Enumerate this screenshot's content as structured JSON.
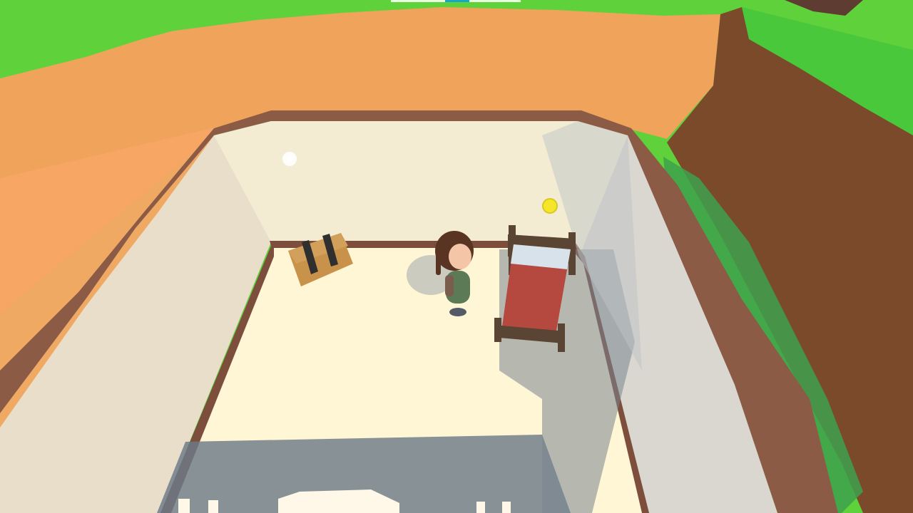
{
  "game": {
    "view": "isometric-room",
    "hud": {
      "top_indicator_color": "#18a7c8"
    },
    "room": {
      "floor_color": "#fff6d6",
      "wall_color": "#f2ead0",
      "wall_trim_color": "#8a5a45",
      "grass_color": "#5fd13a",
      "dirt_color": "#f0a35a",
      "cliff_color": "#7a4a2c"
    },
    "objects": [
      {
        "name": "wooden-chest",
        "color": "#c8924a",
        "band_color": "#2f2f2f"
      },
      {
        "name": "bed",
        "frame_color": "#5a4534",
        "blanket_color": "#b5483f",
        "pillow_color": "#d8e2ea"
      },
      {
        "name": "player-character",
        "hair_color": "#5a3422",
        "clothes_color": "#5d7a57"
      },
      {
        "name": "yellow-collectible-orb",
        "color": "#f6e62b"
      },
      {
        "name": "white-light-orb",
        "color": "#ffffff"
      }
    ]
  }
}
